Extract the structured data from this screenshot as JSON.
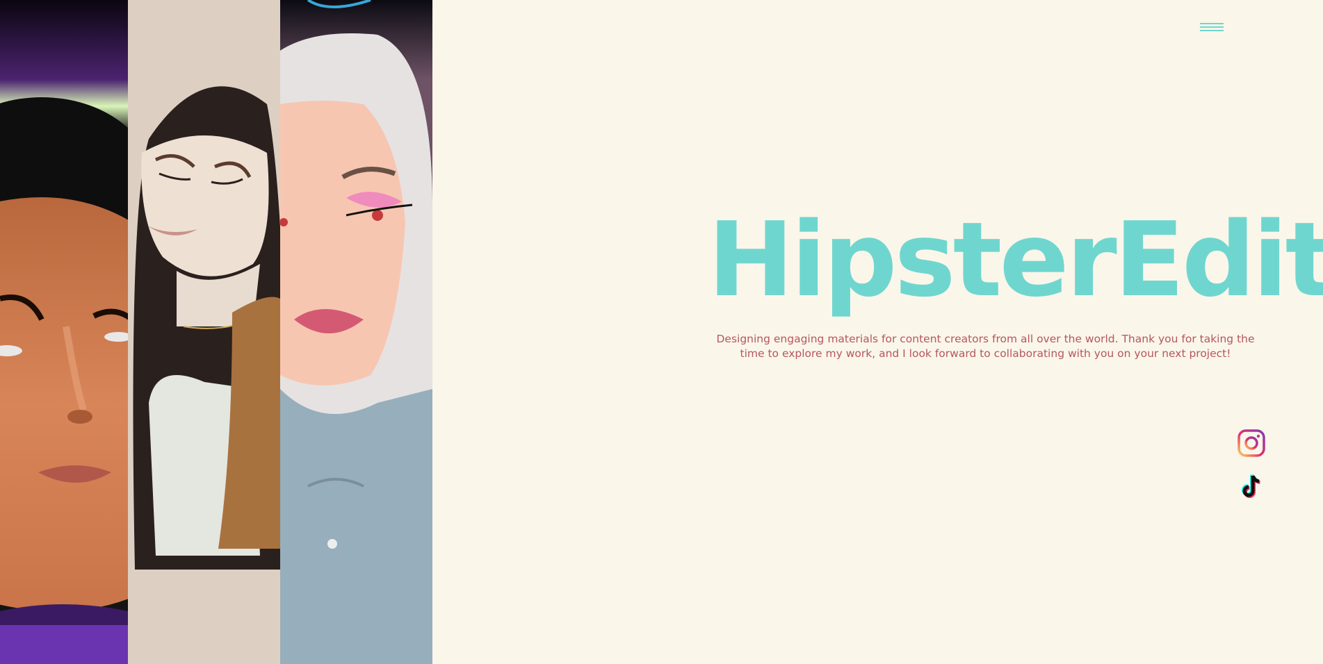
{
  "header": {
    "menu_icon": "hamburger-menu-icon"
  },
  "hero": {
    "title": "HipsterEditz",
    "subtitle": "Designing engaging materials for content creators from all over the world. Thank you for taking the time to explore my work, and I look forward to collaborating with you on your next project!"
  },
  "social": {
    "items": [
      {
        "icon": "instagram-icon"
      },
      {
        "icon": "tiktok-icon"
      }
    ]
  },
  "colors": {
    "background": "#faf6ea",
    "accent": "#6fd6cf",
    "subtitle": "#b7565c"
  }
}
